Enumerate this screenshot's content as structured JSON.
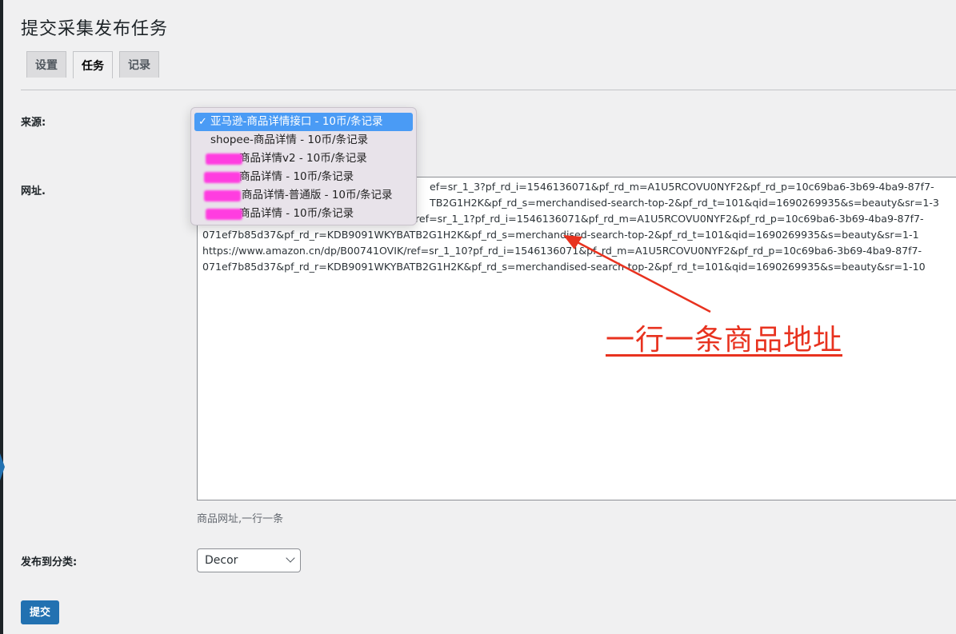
{
  "page": {
    "title": "提交采集发布任务"
  },
  "tabs": [
    {
      "label": "设置",
      "active": false
    },
    {
      "label": "任务",
      "active": true
    },
    {
      "label": "记录",
      "active": false
    }
  ],
  "form": {
    "source_label": "来源:",
    "source_options": [
      {
        "label": "亚马逊-商品详情接口 - 10币/条记录",
        "selected": true
      },
      {
        "label": "shopee-商品详情 - 10币/条记录",
        "selected": false
      },
      {
        "label": "商品详情v2 - 10币/条记录",
        "selected": false
      },
      {
        "label": "商品详情 - 10币/条记录",
        "selected": false
      },
      {
        "label": "商品详情-普通版 - 10币/条记录",
        "selected": false
      },
      {
        "label": "商品详情 - 10币/条记录",
        "selected": false
      }
    ],
    "url_label": "网址.",
    "url_lines": [
      "ef=sr_1_3?pf_rd_i=1546136071&pf_rd_m=A1U5RCOVU0NYF2&pf_rd_p=10c69ba6-3b69-4ba9-87f7-",
      "TB2G1H2K&pf_rd_s=merchandised-search-top-2&pf_rd_t=101&qid=1690269935&s=beauty&sr=1-3",
      "ref=sr_1_1?pf_rd_i=1546136071&pf_rd_m=A1U5RCOVU0NYF2&pf_rd_p=10c69ba6-3b69-4ba9-87f7-",
      "071ef7b85d37&pf_rd_r=KDB9091WKYBATB2G1H2K&pf_rd_s=merchandised-search-top-2&pf_rd_t=101&qid=1690269935&s=beauty&sr=1-1",
      "https://www.amazon.cn/dp/B00741OVIK/ref=sr_1_10?pf_rd_i=1546136071&pf_rd_m=A1U5RCOVU0NYF2&pf_rd_p=10c69ba6-3b69-4ba9-87f7-",
      "071ef7b85d37&pf_rd_r=KDB9091WKYBATB2G1H2K&pf_rd_s=merchandised-search-top-2&pf_rd_t=101&qid=1690269935&s=beauty&sr=1-10"
    ],
    "url_hint": "商品网址,一行一条",
    "category_label": "发布到分类:",
    "category_value": "Decor",
    "submit_label": "提交"
  },
  "annotation": {
    "text": "一行一条商品地址",
    "color": "#e8321f"
  },
  "colors": {
    "accent": "#2271b1",
    "selected_option": "#4a9bf5",
    "redaction": "#ff3de0"
  }
}
